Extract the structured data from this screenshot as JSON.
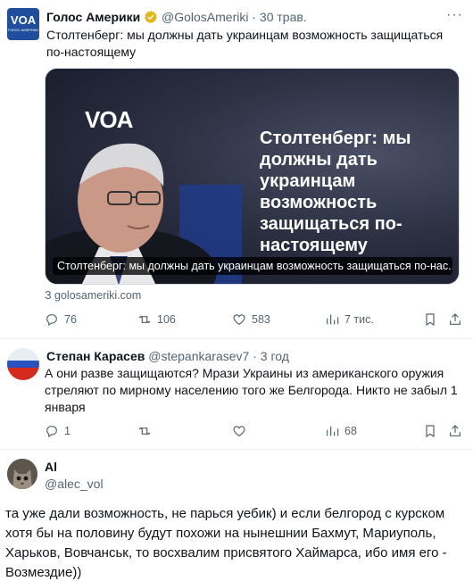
{
  "tweet1": {
    "avatar_text": "VOA",
    "avatar_sub": "ГОЛОС АМЕРИКИ",
    "author": "Голос Америки",
    "handle": "@GolosAmeriki",
    "separator": "·",
    "time": "30 трав.",
    "text": "Столтенберг: мы должны дать украинцам возможность защищаться по-настоящему",
    "card": {
      "logo": "VOA",
      "headline": "Столтенберг: мы должны дать украинцам возможность защищаться по-настоящему",
      "caption": "Столтенберг: мы должны дать украинцам возможность защищаться по-нас...",
      "domain": "З golosameriki.com"
    },
    "actions": {
      "replies": "76",
      "retweets": "106",
      "likes": "583",
      "views": "7 тис."
    }
  },
  "tweet2": {
    "author": "Степан Карасев",
    "handle": "@stepankarasev7",
    "separator": "·",
    "time": "3 год",
    "text": "А они разве защищаются? Мрази Украины из американского оружия стреляют по мирному населению того же Белгорода. Никто не забыл 1 января",
    "actions": {
      "replies": "1",
      "retweets": "",
      "likes": "",
      "views": "68"
    }
  },
  "tweet3": {
    "author": "Al",
    "handle": "@alec_vol",
    "text": "та уже дали возможность, не парься уебик) и если  белгород с курском хотя бы на половину будут похожи на нынешнии Бахмут, Мариуполь, Харьков, Вовчанськ, то восхвалим присвятого Хаймарса, ибо имя его - Возмездие))"
  },
  "icons": [
    "verified-badge-icon",
    "more-icon",
    "reply-icon",
    "retweet-icon",
    "like-icon",
    "views-icon",
    "bookmark-icon",
    "share-icon"
  ],
  "colors": {
    "muted": "#536471",
    "verified": "#e2b719",
    "divider": "#eff3f4",
    "voa_blue": "#1f4f9c"
  }
}
